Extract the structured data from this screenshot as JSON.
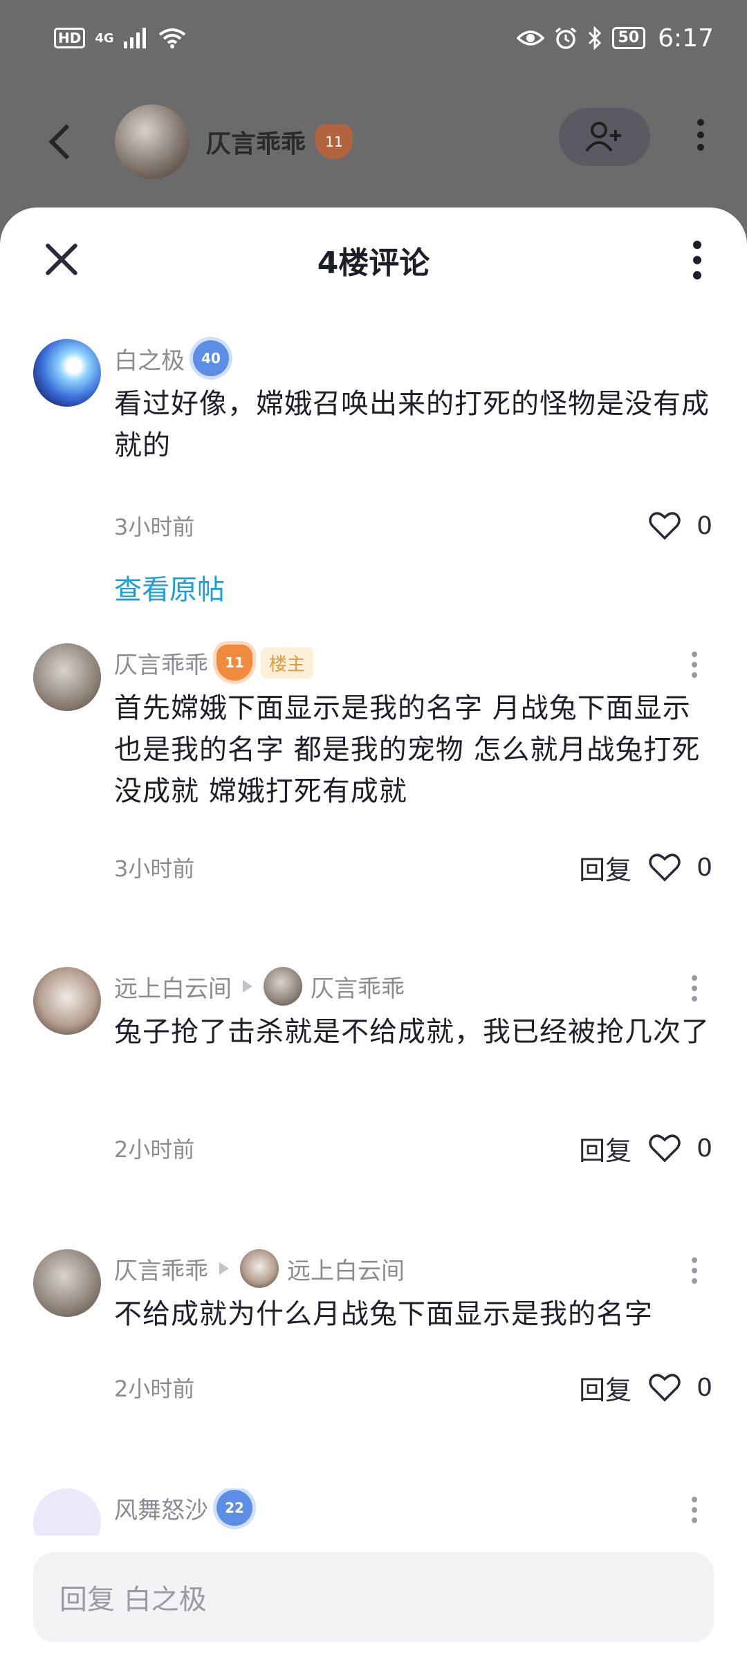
{
  "status_bar": {
    "hd": "HD",
    "network": "4G",
    "battery": "50",
    "time": "6:17"
  },
  "background_header": {
    "author_name": "仄言乖乖",
    "author_level": "11"
  },
  "sheet": {
    "title": "4楼评论"
  },
  "main_comment": {
    "user": "白之极",
    "level": "40",
    "text": "看过好像，嫦娥召唤出来的打死的怪物是没有成就的",
    "time": "3小时前",
    "likes": "0",
    "view_original": "查看原帖"
  },
  "replies": [
    {
      "user": "仄言乖乖",
      "level": "11",
      "owner_tag": "楼主",
      "text": "首先嫦娥下面显示是我的名字 月战兔下面显示也是我的名字 都是我的宠物 怎么就月战兔打死没成就 嫦娥打死有成就",
      "time": "3小时前",
      "reply_label": "回复",
      "likes": "0"
    },
    {
      "user": "远上白云间",
      "reply_to": "仄言乖乖",
      "text": "兔子抢了击杀就是不给成就，我已经被抢几次了",
      "time": "2小时前",
      "reply_label": "回复",
      "likes": "0"
    },
    {
      "user": "仄言乖乖",
      "reply_to": "远上白云间",
      "text": "不给成就为什么月战兔下面显示是我的名字",
      "time": "2小时前",
      "reply_label": "回复",
      "likes": "0"
    },
    {
      "user": "风舞怒沙",
      "level": "22"
    }
  ],
  "reply_input": {
    "placeholder": "回复 白之极"
  }
}
